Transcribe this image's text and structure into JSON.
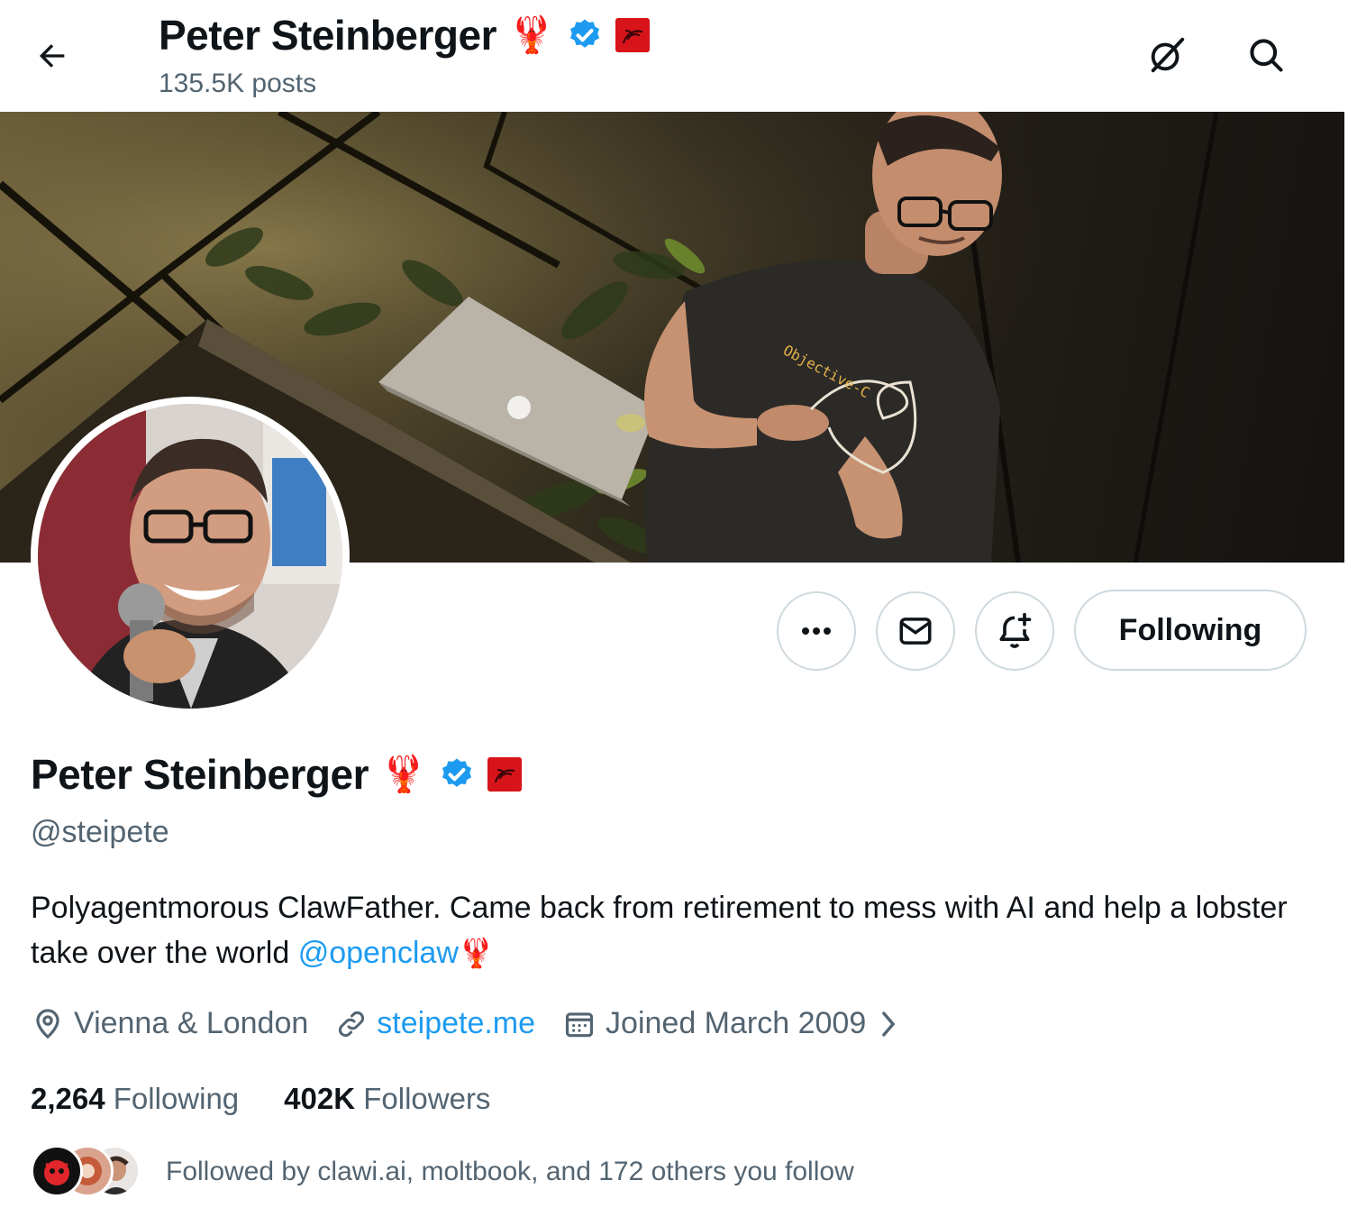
{
  "header": {
    "name": "Peter Steinberger",
    "posts": "135.5K posts"
  },
  "actions": {
    "following_label": "Following"
  },
  "profile": {
    "name": "Peter Steinberger",
    "handle": "@steipete",
    "bio_text": "Polyagentmorous ClawFather. Came back from retirement to mess with AI and help a lobster take over the world ",
    "bio_mention": "@openclaw",
    "bio_emoji": "🦞",
    "lobster_emoji": "🦞",
    "location": "Vienna & London",
    "website": "steipete.me",
    "joined": "Joined March 2009",
    "following_count": "2,264",
    "following_label": "Following",
    "followers_count": "402K",
    "followers_label": "Followers",
    "followed_by": "Followed by clawi.ai, moltbook, and 172 others you follow"
  },
  "banner": {
    "shirt_text": "Objective-C"
  },
  "colors": {
    "accent": "#1d9bf0",
    "text_primary": "#0f1419",
    "text_secondary": "#536471",
    "border": "#cfd9de",
    "badge_red": "#d7141a"
  },
  "icons": {
    "back": "arrow-left-icon",
    "grok": "grok-slash-icon",
    "search": "search-icon",
    "more": "more-icon",
    "message": "mail-icon",
    "notify": "bell-plus-icon",
    "location": "map-pin-icon",
    "link": "link-icon",
    "calendar": "calendar-icon",
    "verified": "verified-badge-icon"
  }
}
